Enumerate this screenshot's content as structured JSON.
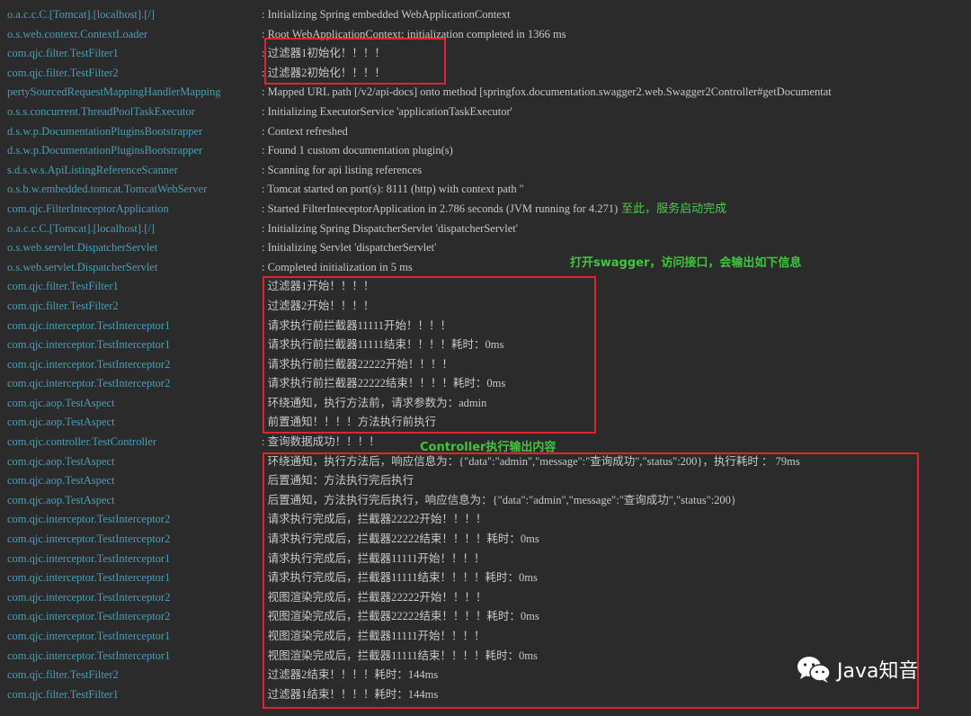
{
  "log_rows": [
    {
      "logger": "o.a.c.c.C.[Tomcat].[localhost].[/]",
      "message": ": Initializing Spring embedded WebApplicationContext"
    },
    {
      "logger": "o.s.web.context.ContextLoader",
      "message": ": Root WebApplicationContext: initialization completed in 1366 ms"
    },
    {
      "logger": "com.qjc.filter.TestFilter1",
      "message": ": 过滤器1初始化！！！！"
    },
    {
      "logger": "com.qjc.filter.TestFilter2",
      "message": ": 过滤器2初始化！！！！"
    },
    {
      "logger": "pertySourcedRequestMappingHandlerMapping",
      "message": ": Mapped URL path [/v2/api-docs] onto method [springfox.documentation.swagger2.web.Swagger2Controller#getDocumentat"
    },
    {
      "logger": "o.s.s.concurrent.ThreadPoolTaskExecutor",
      "message": ": Initializing ExecutorService 'applicationTaskExecutor'"
    },
    {
      "logger": "d.s.w.p.DocumentationPluginsBootstrapper",
      "message": ": Context refreshed"
    },
    {
      "logger": "d.s.w.p.DocumentationPluginsBootstrapper",
      "message": ": Found 1 custom documentation plugin(s)"
    },
    {
      "logger": "s.d.s.w.s.ApiListingReferenceScanner",
      "message": ": Scanning for api listing references"
    },
    {
      "logger": "o.s.b.w.embedded.tomcat.TomcatWebServer",
      "message": ": Tomcat started on port(s): 8111 (http) with context path ''"
    },
    {
      "logger": "com.qjc.FilterInteceptorApplication",
      "message": ": Started FilterInteceptorApplication in 2.786 seconds (JVM running for 4.271)",
      "note": "至此，服务启动完成"
    },
    {
      "logger": "o.a.c.c.C.[Tomcat].[localhost].[/]",
      "message": ": Initializing Spring DispatcherServlet 'dispatcherServlet'"
    },
    {
      "logger": "o.s.web.servlet.DispatcherServlet",
      "message": ": Initializing Servlet 'dispatcherServlet'"
    },
    {
      "logger": "o.s.web.servlet.DispatcherServlet",
      "message": ": Completed initialization in 5 ms"
    },
    {
      "logger": "com.qjc.filter.TestFilter1",
      "message": ": 过滤器1开始！！！！"
    },
    {
      "logger": "com.qjc.filter.TestFilter2",
      "message": ": 过滤器2开始！！！！"
    },
    {
      "logger": "com.qjc.interceptor.TestInterceptor1",
      "message": ": 请求执行前拦截器11111开始！！！！"
    },
    {
      "logger": "com.qjc.interceptor.TestInterceptor1",
      "message": ": 请求执行前拦截器11111结束！！！！耗时：0ms"
    },
    {
      "logger": "com.qjc.interceptor.TestInterceptor2",
      "message": ": 请求执行前拦截器22222开始！！！！"
    },
    {
      "logger": "com.qjc.interceptor.TestInterceptor2",
      "message": ": 请求执行前拦截器22222结束！！！！耗时：0ms"
    },
    {
      "logger": "com.qjc.aop.TestAspect",
      "message": ": 环绕通知，执行方法前，请求参数为：admin"
    },
    {
      "logger": "com.qjc.aop.TestAspect",
      "message": ": 前置通知！！！！方法执行前执行"
    },
    {
      "logger": "com.qjc.controller.TestController",
      "message": ": 查询数据成功！！！！"
    },
    {
      "logger": "com.qjc.aop.TestAspect",
      "message": ": 环绕通知，执行方法后，响应信息为：{\"data\":\"admin\",\"message\":\"查询成功\",\"status\":200}，执行耗时 ： 79ms"
    },
    {
      "logger": "com.qjc.aop.TestAspect",
      "message": ": 后置通知：方法执行完后执行"
    },
    {
      "logger": "com.qjc.aop.TestAspect",
      "message": ": 后置通知，方法执行完后执行，响应信息为：{\"data\":\"admin\",\"message\":\"查询成功\",\"status\":200}"
    },
    {
      "logger": "com.qjc.interceptor.TestInterceptor2",
      "message": ": 请求执行完成后，拦截器22222开始！！！！"
    },
    {
      "logger": "com.qjc.interceptor.TestInterceptor2",
      "message": ": 请求执行完成后，拦截器22222结束！！！！耗时：0ms"
    },
    {
      "logger": "com.qjc.interceptor.TestInterceptor1",
      "message": ": 请求执行完成后，拦截器11111开始！！！！"
    },
    {
      "logger": "com.qjc.interceptor.TestInterceptor1",
      "message": ": 请求执行完成后，拦截器11111结束！！！！耗时：0ms"
    },
    {
      "logger": "com.qjc.interceptor.TestInterceptor2",
      "message": ": 视图渲染完成后，拦截器22222开始！！！！"
    },
    {
      "logger": "com.qjc.interceptor.TestInterceptor2",
      "message": ": 视图渲染完成后，拦截器22222结束！！！！耗时：0ms"
    },
    {
      "logger": "com.qjc.interceptor.TestInterceptor1",
      "message": ": 视图渲染完成后，拦截器11111开始！！！！"
    },
    {
      "logger": "com.qjc.interceptor.TestInterceptor1",
      "message": ": 视图渲染完成后，拦截器11111结束！！！！耗时：0ms"
    },
    {
      "logger": "com.qjc.filter.TestFilter2",
      "message": ": 过滤器2结束！！！！耗时：144ms"
    },
    {
      "logger": "com.qjc.filter.TestFilter1",
      "message": ": 过滤器1结束！！！！耗时：144ms"
    }
  ],
  "annotations": {
    "swagger_note": "打开swagger，访问接口，会输出如下信息",
    "controller_note": "Controller执行输出内容"
  },
  "watermark": {
    "text": "Java知音",
    "icon": "wechat-icon"
  },
  "colors": {
    "background": "#2b2b2b",
    "logger": "#4a9eb5",
    "message": "#c8c8c8",
    "annotation": "#3ec63e",
    "highlight_box": "#e0242b"
  }
}
